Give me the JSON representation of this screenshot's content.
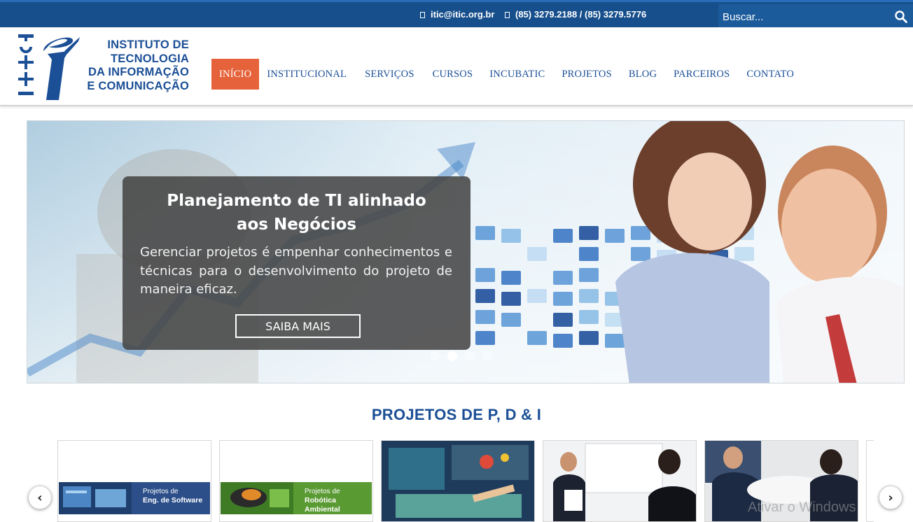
{
  "topbar": {
    "email": "itic@itic.org.br",
    "phone": "(85) 3279.2188 / (85) 3279.5776",
    "email_icon": "envelope-icon",
    "phone_icon": "phone-icon",
    "search_placeholder": "Buscar...",
    "search_icon": "search-icon"
  },
  "logo": {
    "vertical_text": "ITIC",
    "line1": "INSTITUTO DE",
    "line2": "TECNOLOGIA",
    "line3": "DA INFORMAÇÃO",
    "line4": "E COMUNICAÇÃO"
  },
  "nav": {
    "items": [
      {
        "label": "INÍCIO",
        "active": true
      },
      {
        "label": "INSTITUCIONAL"
      },
      {
        "label": "SERVIÇOS"
      },
      {
        "label": "CURSOS"
      },
      {
        "label": "INCUBATIC"
      },
      {
        "label": "PROJETOS"
      },
      {
        "label": "BLOG"
      },
      {
        "label": "PARCEIROS"
      },
      {
        "label": "CONTATO"
      }
    ]
  },
  "slider": {
    "title_line1": "Planejamento de TI alinhado",
    "title_line2": "aos Negócios",
    "text": "Gerenciar projetos é empenhar conhecimentos e técnicas para o desenvolvimento do projeto de maneira eficaz.",
    "button": "SAIBA MAIS",
    "active_slide": 2,
    "slide_count": 4
  },
  "section": {
    "title": "PROJETOS DE P, D & I"
  },
  "carousel": {
    "cards": [
      {
        "small": "Projetos de",
        "big": "Eng. de Software"
      },
      {
        "small": "Projetos de",
        "big": "Robótica Ambiental"
      }
    ],
    "prev": "‹",
    "next": "›"
  },
  "watermark": "Ativar o Windows",
  "colors": {
    "topbar": "#174f8c",
    "brand_blue": "#1b4f96",
    "active_nav": "#e5623a"
  }
}
